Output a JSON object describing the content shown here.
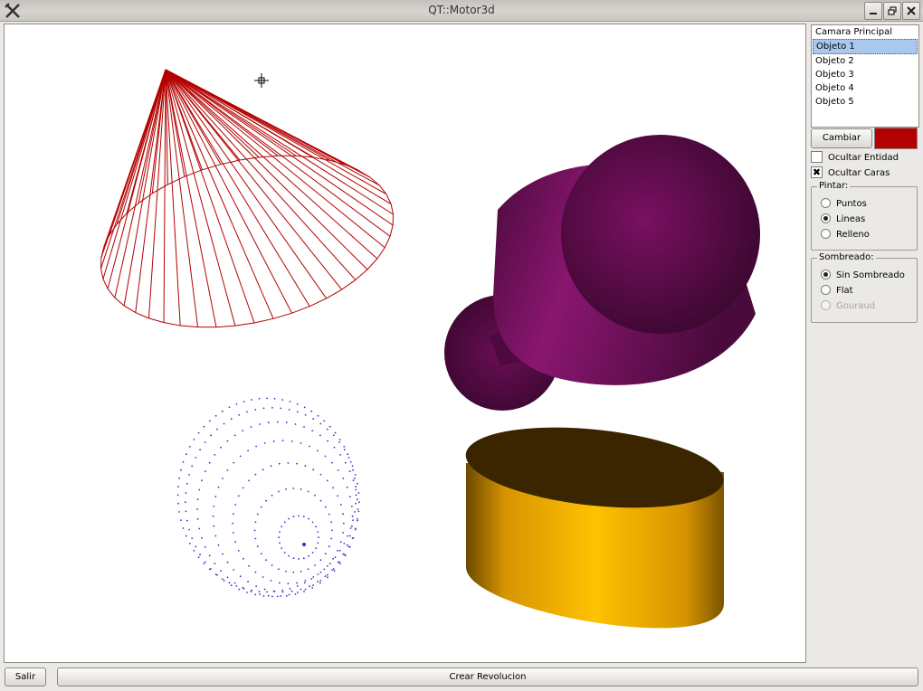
{
  "window": {
    "title": "QT::Motor3d",
    "icon": "tools-cross-icon",
    "controls": [
      "minimize-icon",
      "maximize-icon",
      "close-icon"
    ]
  },
  "objects_list": {
    "items": [
      "Camara Principal",
      "Objeto 1",
      "Objeto 2",
      "Objeto 3",
      "Objeto 4",
      "Objeto 5"
    ],
    "selected": "Objeto 1"
  },
  "color_panel": {
    "change_label": "Cambiar",
    "current_color": "#b30000"
  },
  "options": {
    "hide_entity_label": "Ocultar Entidad",
    "hide_entity_checked": false,
    "hide_faces_label": "Ocultar Caras",
    "hide_faces_checked": true
  },
  "paint_group": {
    "title": "Pintar:",
    "options": [
      "Puntos",
      "Lineas",
      "Relleno"
    ],
    "selected": "Lineas"
  },
  "shading_group": {
    "title": "Sombreado:",
    "options": [
      "Sin Sombreado",
      "Flat",
      "Gouraud"
    ],
    "selected": "Sin Sombreado",
    "disabled": [
      "Gouraud"
    ]
  },
  "bottom": {
    "exit_label": "Salir",
    "create_label": "Crear Revolucion"
  },
  "scene_colors": {
    "wireframe": "#b30000",
    "points": "#3333cc",
    "purple_solid": "#7a1062",
    "gold_solid": "#f5b000",
    "gold_top": "#3a2500"
  }
}
